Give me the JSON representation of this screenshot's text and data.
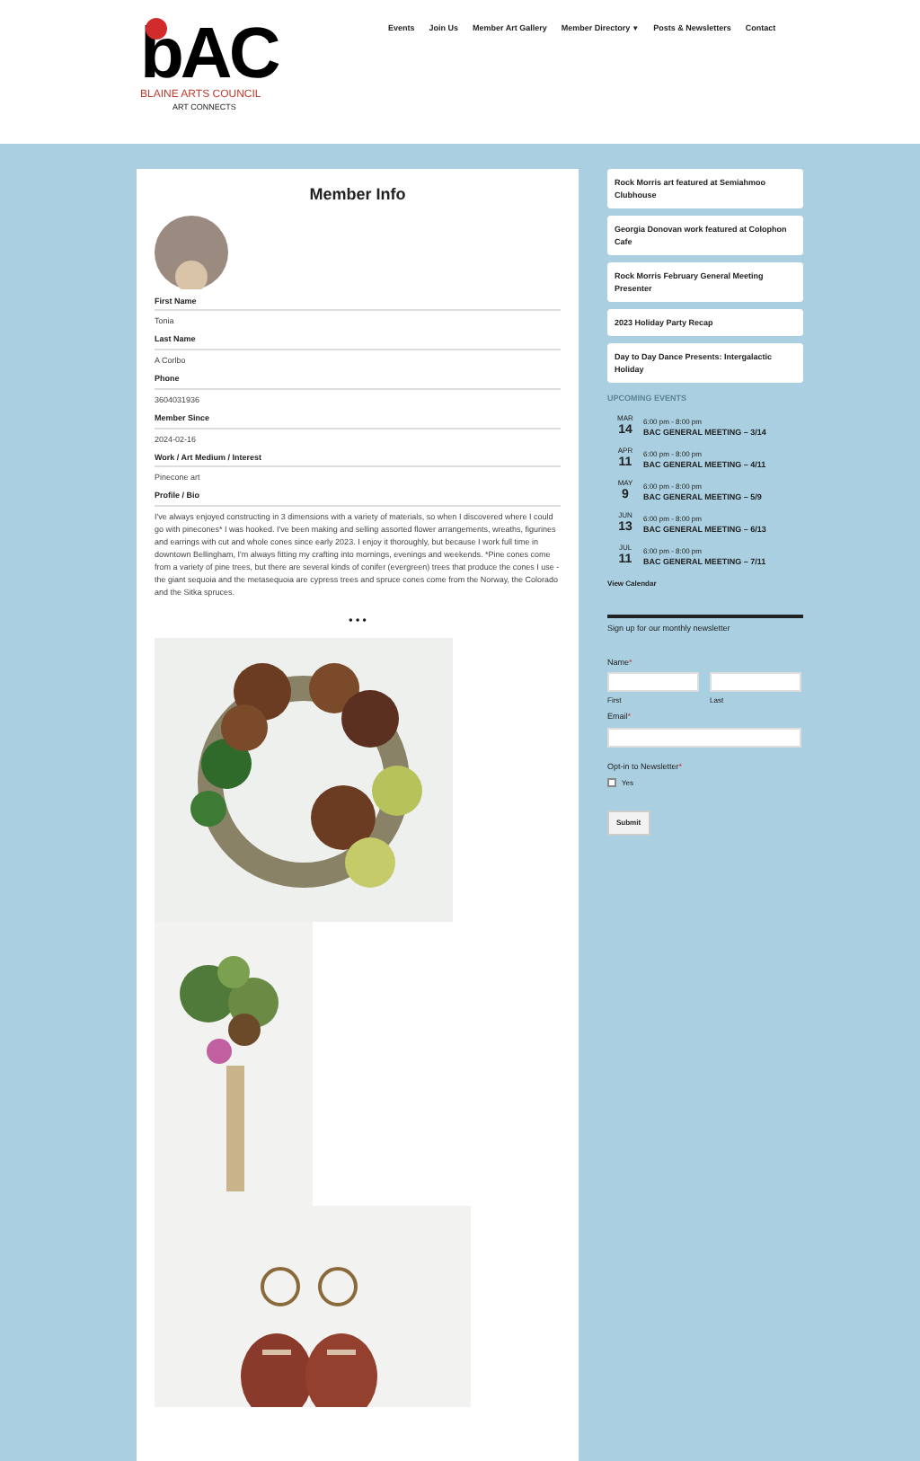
{
  "logo": {
    "letters": "bAC",
    "name": "BLAINE ARTS COUNCIL",
    "tagline": "ART CONNECTS"
  },
  "nav": [
    {
      "label": "Events"
    },
    {
      "label": "Join Us"
    },
    {
      "label": "Member Art Gallery"
    },
    {
      "label": "Member Directory",
      "caret": "▼"
    },
    {
      "label": "Posts & Newsletters"
    },
    {
      "label": "Contact"
    }
  ],
  "member": {
    "title": "Member Info",
    "fields": [
      {
        "label": "First Name",
        "value": "Tonia"
      },
      {
        "label": "Last Name",
        "value": "A Corlbo"
      },
      {
        "label": "Phone",
        "value": "3604031936"
      },
      {
        "label": "Member Since",
        "value": "2024-02-16"
      },
      {
        "label": "Work / Art Medium / Interest",
        "value": "Pinecone art"
      },
      {
        "label": "Profile / Bio",
        "value": "I've always enjoyed constructing in 3 dimensions with a variety of materials, so when I discovered where I could go with pinecones* I was hooked. I've been making and selling assorted flower arrangements, wreaths, figurines and earrings with cut and whole cones since early 2023. I enjoy it thoroughly, but because I work full time in downtown Bellingham, I'm always fitting my crafting into mornings, evenings and weekends. *Pine cones come from a variety of pine trees, but there are several kinds of conifer (evergreen) trees that produce the cones I use - the giant sequoia and the metasequoia are cypress trees and spruce cones come from the Norway, the Colorado and the Sitka spruces."
      }
    ],
    "more": "• • •",
    "gallery": [
      {
        "kind": "wreath"
      },
      {
        "kind": "bouquet"
      },
      {
        "kind": "earrings"
      }
    ]
  },
  "posts": [
    "Rock Morris art featured at Semiahmoo Clubhouse",
    "Georgia Donovan work featured at Colophon Cafe",
    "Rock Morris February General Meeting Presenter",
    "2023 Holiday Party Recap",
    "Day to Day Dance Presents: Intergalactic Holiday"
  ],
  "events": {
    "heading": "UPCOMING EVENTS",
    "items": [
      {
        "month": "MAR",
        "day": "14",
        "time": "6:00 pm - 8:00 pm",
        "title": "BAC GENERAL MEETING – 3/14"
      },
      {
        "month": "APR",
        "day": "11",
        "time": "6:00 pm - 8:00 pm",
        "title": "BAC GENERAL MEETING – 4/11"
      },
      {
        "month": "MAY",
        "day": "9",
        "time": "6:00 pm - 8:00 pm",
        "title": "BAC GENERAL MEETING – 5/9"
      },
      {
        "month": "JUN",
        "day": "13",
        "time": "6:00 pm - 8:00 pm",
        "title": "BAC GENERAL MEETING – 6/13"
      },
      {
        "month": "JUL",
        "day": "11",
        "time": "6:00 pm - 8:00 pm",
        "title": "BAC GENERAL MEETING – 7/11"
      }
    ],
    "link": "View Calendar"
  },
  "newsletter": {
    "title": "Sign up for our monthly newsletter",
    "name_label": "Name",
    "first": "First",
    "last": "Last",
    "email_label": "Email",
    "required": "*",
    "optin_label": "Opt-in to Newsletter",
    "option": {
      "label": "Yes",
      "checked": false
    },
    "submit": "Submit"
  }
}
